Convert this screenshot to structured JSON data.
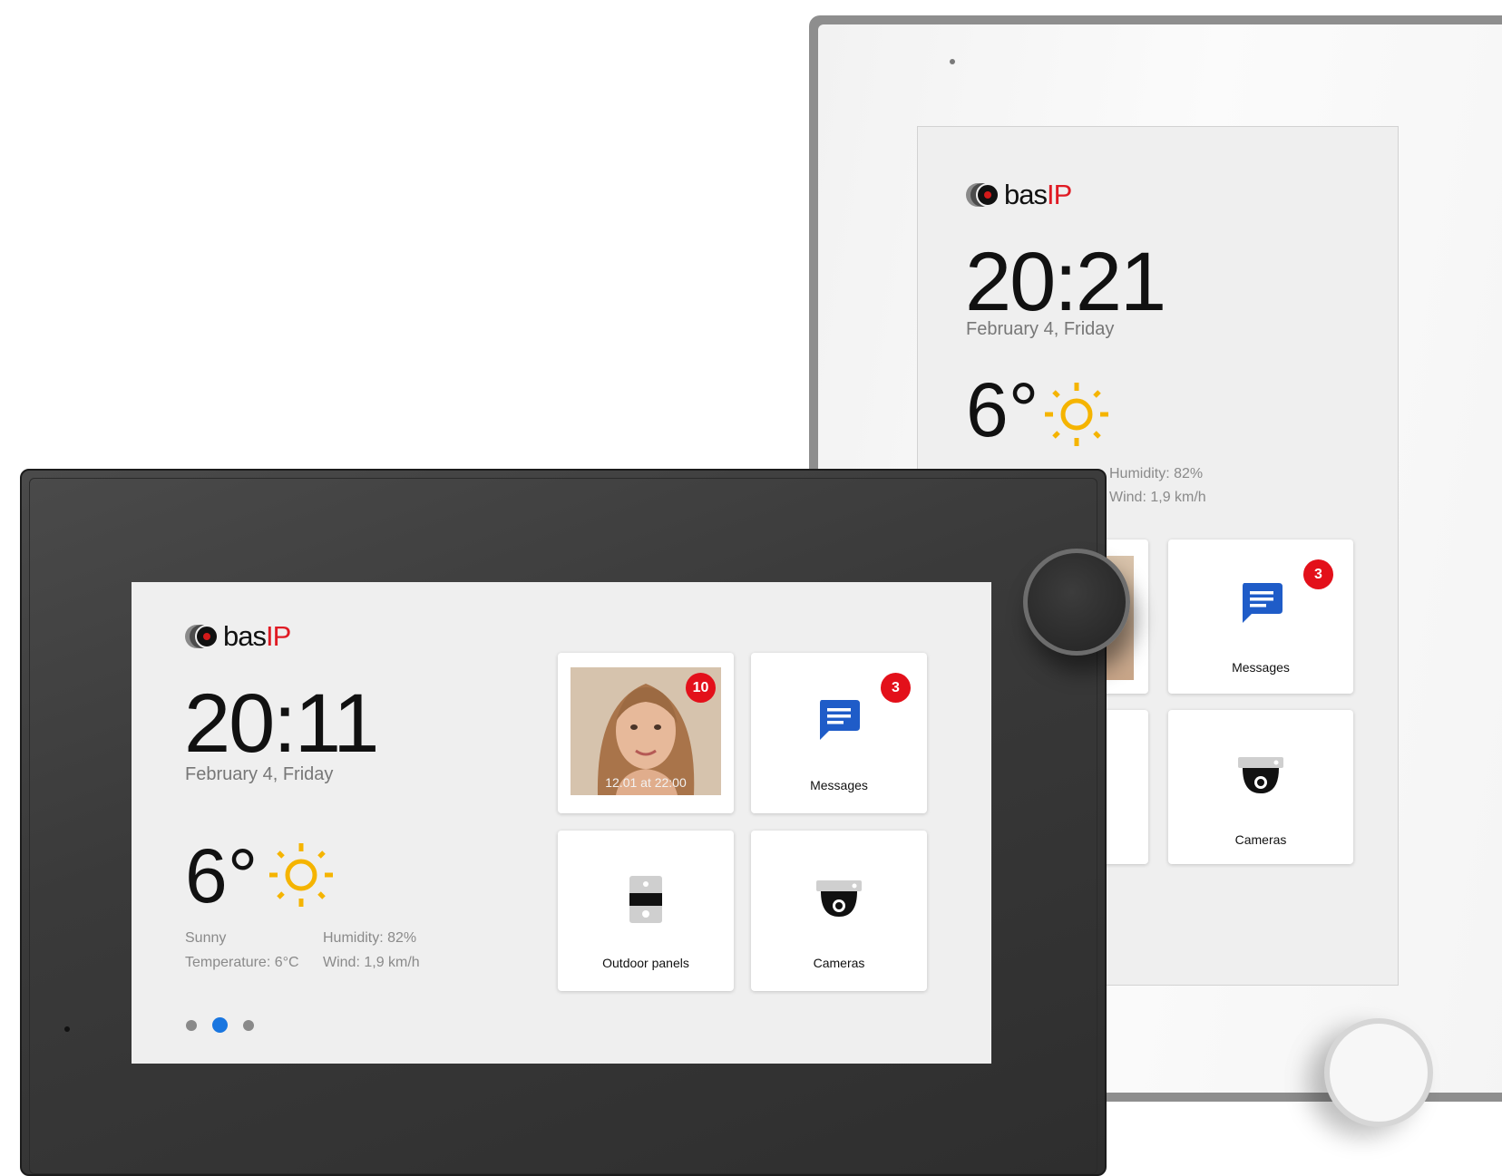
{
  "brand": {
    "name": "bas",
    "suffix": "IP"
  },
  "front_panel": {
    "time": "20:11",
    "date": "February 4, Friday",
    "weather": {
      "temperature_big": "6°",
      "condition": "Sunny",
      "temperature_line": "Temperature: 6°C",
      "humidity": "Humidity: 82%",
      "wind": "Wind: 1,9 km/h",
      "icon": "sun-icon"
    },
    "tiles": [
      {
        "kind": "visitor-photo",
        "caption": "12.01 at 22:00",
        "badge": "10"
      },
      {
        "kind": "messages",
        "label": "Messages",
        "badge": "3",
        "icon": "chat-bubble-icon"
      },
      {
        "kind": "outdoor-panels",
        "label": "Outdoor panels",
        "icon": "door-panel-icon"
      },
      {
        "kind": "cameras",
        "label": "Cameras",
        "icon": "dome-camera-icon"
      }
    ],
    "pager": {
      "count": 3,
      "active_index": 1
    }
  },
  "back_panel": {
    "time": "20:21",
    "date": "February 4, Friday",
    "weather": {
      "temperature_big": "6°",
      "humidity": "Humidity: 82%",
      "wind": "Wind: 1,9 km/h",
      "icon": "sun-icon"
    },
    "tiles": [
      {
        "kind": "messages",
        "label": "Messages",
        "badge": "3",
        "icon": "chat-bubble-icon"
      },
      {
        "kind": "cameras",
        "label": "Cameras",
        "icon": "dome-camera-icon"
      }
    ]
  },
  "colors": {
    "accent_blue": "#1976e0",
    "badge_red": "#e3101a",
    "sun_yellow": "#f5b400",
    "message_blue": "#1f5cc8",
    "brand_red": "#e01b24"
  }
}
